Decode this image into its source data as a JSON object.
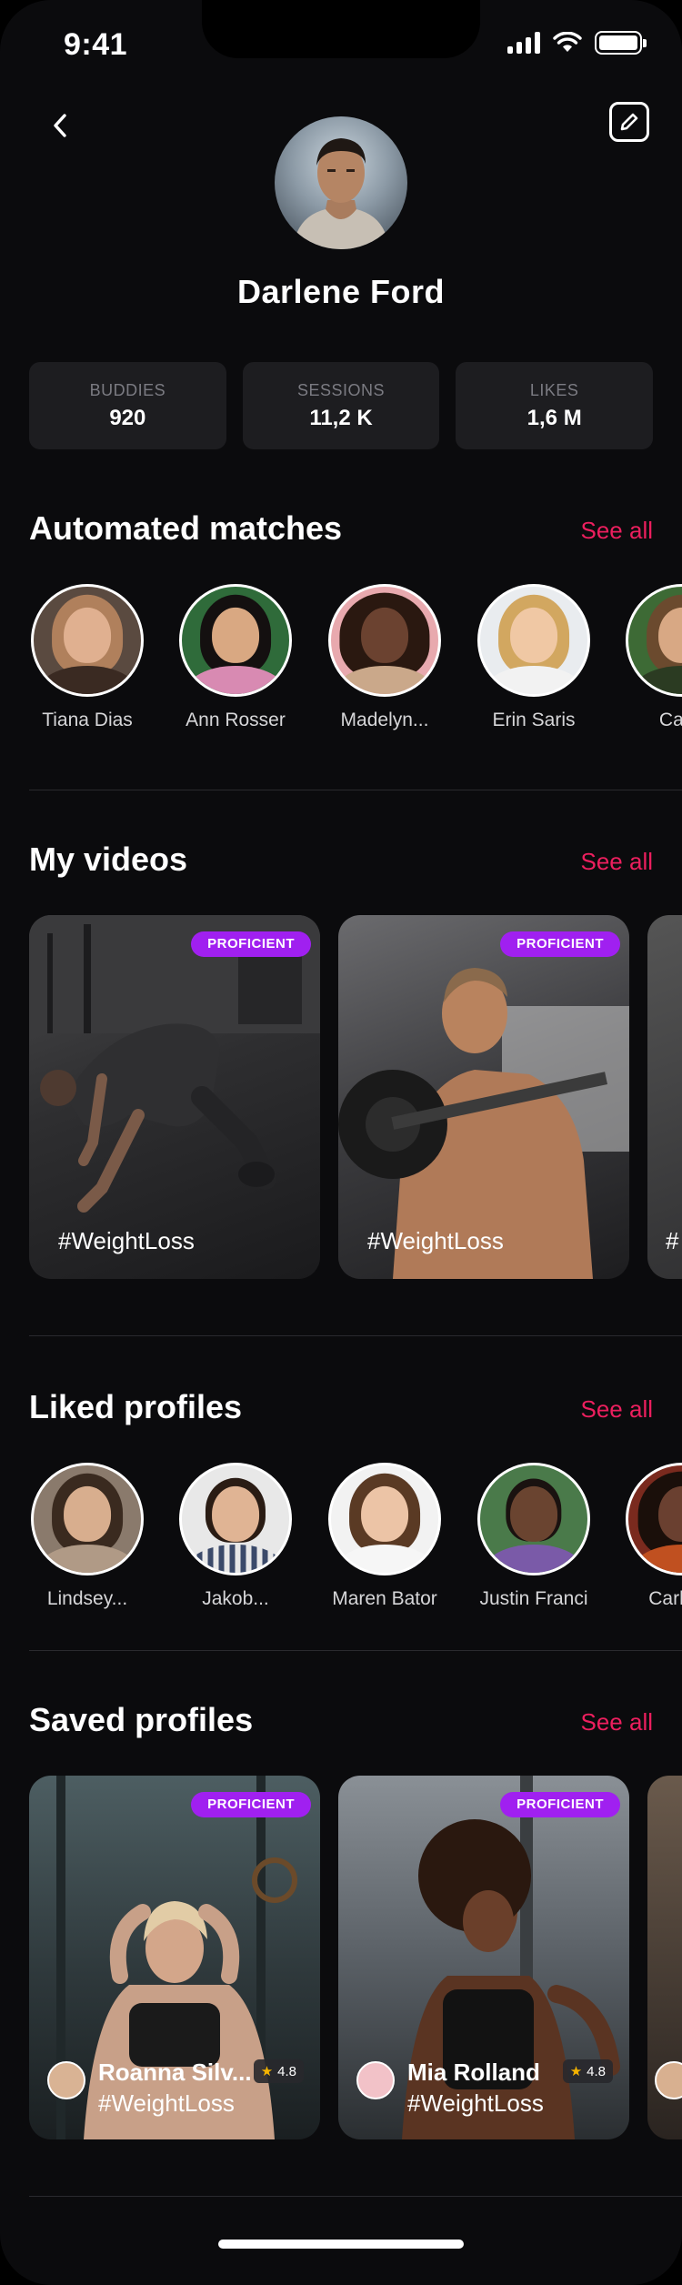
{
  "status_bar": {
    "time": "9:41"
  },
  "profile": {
    "name": "Darlene Ford"
  },
  "stats": [
    {
      "label": "BUDDIES",
      "value": "920"
    },
    {
      "label": "SESSIONS",
      "value": "11,2 K"
    },
    {
      "label": "LIKES",
      "value": "1,6 M"
    }
  ],
  "automated_matches": {
    "title": "Automated matches",
    "see_all": "See all",
    "items": [
      {
        "name": "Tiana Dias"
      },
      {
        "name": "Ann Rosser"
      },
      {
        "name": "Madelyn..."
      },
      {
        "name": "Erin Saris"
      },
      {
        "name": "Carla"
      }
    ]
  },
  "my_videos": {
    "title": "My videos",
    "see_all": "See all",
    "items": [
      {
        "badge": "PROFICIENT",
        "tag": "#WeightLoss"
      },
      {
        "badge": "PROFICIENT",
        "tag": "#WeightLoss"
      },
      {
        "badge": "",
        "tag": "#"
      }
    ]
  },
  "liked_profiles": {
    "title": "Liked profiles",
    "see_all": "See all",
    "items": [
      {
        "name": "Lindsey..."
      },
      {
        "name": "Jakob..."
      },
      {
        "name": "Maren Bator"
      },
      {
        "name": "Justin Franci"
      },
      {
        "name": "Carla M"
      }
    ]
  },
  "saved_profiles": {
    "title": "Saved profiles",
    "see_all": "See all",
    "items": [
      {
        "badge": "PROFICIENT",
        "name": "Roanna Silv...",
        "rating": "4.8",
        "tag": "#WeightLoss"
      },
      {
        "badge": "PROFICIENT",
        "name": "Mia Rolland",
        "rating": "4.8",
        "tag": "#WeightLoss"
      }
    ]
  },
  "colors": {
    "accent": "#ec1f5e",
    "badge": "#a020f0",
    "background": "#0b0b0d",
    "card": "#1d1d20"
  },
  "icons": {
    "back": "chevron-left-icon",
    "edit": "edit-icon",
    "star": "star-icon"
  }
}
